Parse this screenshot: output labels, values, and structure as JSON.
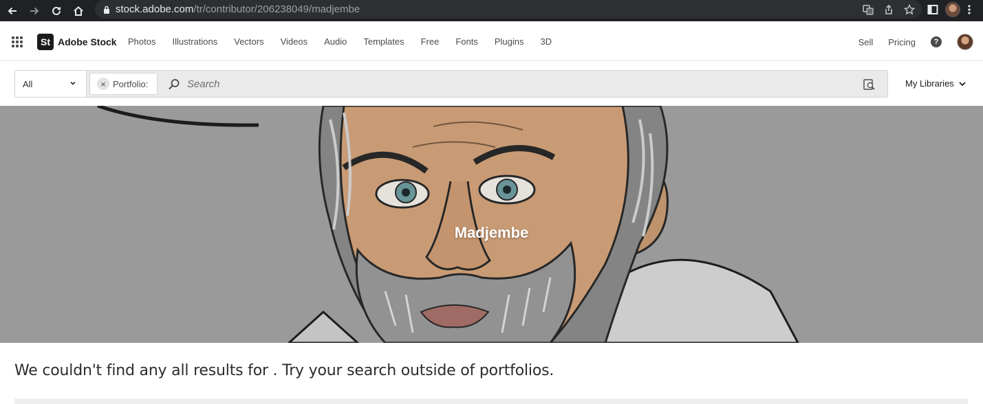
{
  "browser": {
    "url_host": "stock.adobe.com",
    "url_path": "/tr/contributor/206238049/madjembe"
  },
  "header": {
    "logo_mark": "St",
    "brand": "Adobe Stock",
    "nav": [
      "Photos",
      "Illustrations",
      "Vectors",
      "Videos",
      "Audio",
      "Templates",
      "Free",
      "Fonts",
      "Plugins",
      "3D"
    ],
    "sell": "Sell",
    "pricing": "Pricing",
    "help": "?"
  },
  "search": {
    "filter_value": "All",
    "chip_label": "Portfolio:",
    "chip_remove": "×",
    "placeholder": "Search",
    "libraries": "My Libraries"
  },
  "hero": {
    "name": "Madjembe"
  },
  "results": {
    "message": "We couldn't find any all results for . Try your search outside of portfolios."
  }
}
